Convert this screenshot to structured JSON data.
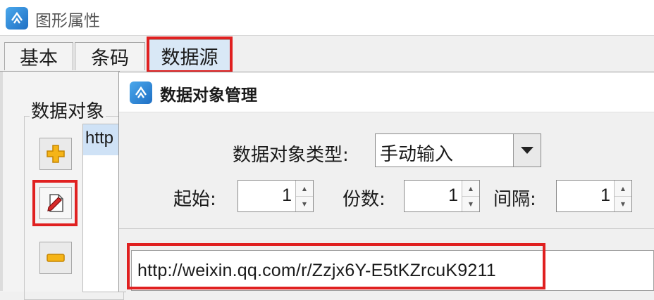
{
  "window": {
    "title": "图形属性"
  },
  "tabs": [
    {
      "label": "基本"
    },
    {
      "label": "条码"
    },
    {
      "label": "数据源",
      "active": true
    }
  ],
  "left_panel": {
    "group_label": "数据对象",
    "list_item": "http"
  },
  "dialog": {
    "title": "数据对象管理",
    "type_label": "数据对象类型:",
    "type_value": "手动输入",
    "start_label": "起始:",
    "start_value": "1",
    "copies_label": "份数:",
    "copies_value": "1",
    "interval_label": "间隔:",
    "interval_value": "1",
    "content_value": "http://weixin.qq.com/r/Zzjx6Y-E5tKZrcuK9211"
  },
  "icons": {
    "app": "app-logo-icon",
    "add": "plus-icon",
    "edit": "edit-pencil-icon",
    "remove": "minus-icon",
    "dropdown": "triangle-down-icon"
  },
  "colors": {
    "highlight": "#e02020",
    "active_tab": "#d9e8f6",
    "selection": "#cfe2f6"
  }
}
